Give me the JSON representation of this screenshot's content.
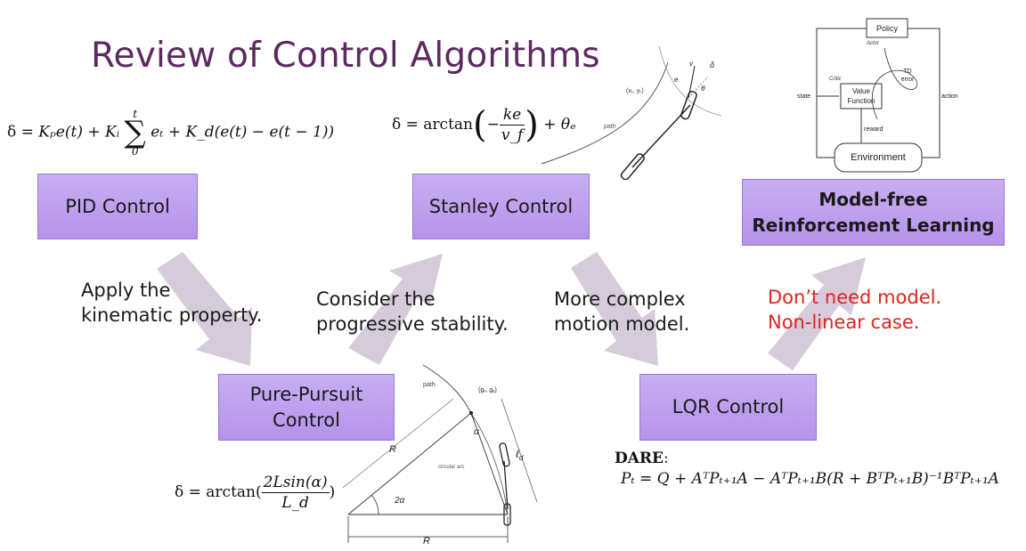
{
  "title": "Review of Control Algorithms",
  "boxes": {
    "pid": "PID Control",
    "stanley": "Stanley Control",
    "rl_line1": "Model-free",
    "rl_line2": "Reinforcement Learning",
    "pp_line1": "Pure-Pursuit",
    "pp_line2": "Control",
    "lqr": "LQR Control"
  },
  "captions": {
    "kinematic_1": "Apply the",
    "kinematic_2": "kinematic property.",
    "stability_1": "Consider the",
    "stability_2": "progressive stability.",
    "motion_1": "More complex",
    "motion_2": "motion model.",
    "model_1": "Don’t need model.",
    "model_2": "Non-linear case."
  },
  "equations": {
    "pid": {
      "lhs": "δ = ",
      "a": "Kₚe(t) + Kᵢ",
      "sum_top": "t",
      "sum_sym": "∑",
      "sum_bot": "0",
      "b": "eₜ + K_d(e(t) − e(t − 1))"
    },
    "stanley": {
      "lhs": "δ = arctan",
      "num": "ke",
      "den": "v_f",
      "rhs": "+ θₑ"
    },
    "pure_pursuit": {
      "lhs": "δ = arctan(",
      "num": "2Lsin(α)",
      "den": "L_d",
      "rhs": ")"
    },
    "dare": {
      "label": "DARE",
      "formula": "Pₜ = Q + AᵀPₜ₊₁A − AᵀPₜ₊₁B(R + BᵀPₜ₊₁B)⁻¹BᵀPₜ₊₁A"
    }
  },
  "rl_diagram": {
    "policy": "Policy",
    "actor": "Actor",
    "critic": "Critic",
    "value_1": "Value",
    "value_2": "Function",
    "td_1": "TD",
    "td_2": "error",
    "state": "state",
    "action": "action",
    "reward": "reward",
    "environment": "Environment"
  },
  "stanley_diagram": {
    "path": "path",
    "point": "(xₜ, yₜ)",
    "e_fa": "e",
    "v": "v",
    "delta": "δ",
    "theta": "θ"
  },
  "pp_diagram": {
    "path": "path",
    "goal": "(gₓ, gᵧ)",
    "alpha": "α",
    "ld": "ℓ",
    "ld_sub": "d",
    "R_diag": "R",
    "two_alpha": "2α",
    "arc": "circular arc",
    "R_base": "R"
  },
  "colors": {
    "title": "#5b2a5e",
    "box_fill": "#b593ea",
    "arrow": "#d6cbdb",
    "red_text": "#e0241c"
  }
}
